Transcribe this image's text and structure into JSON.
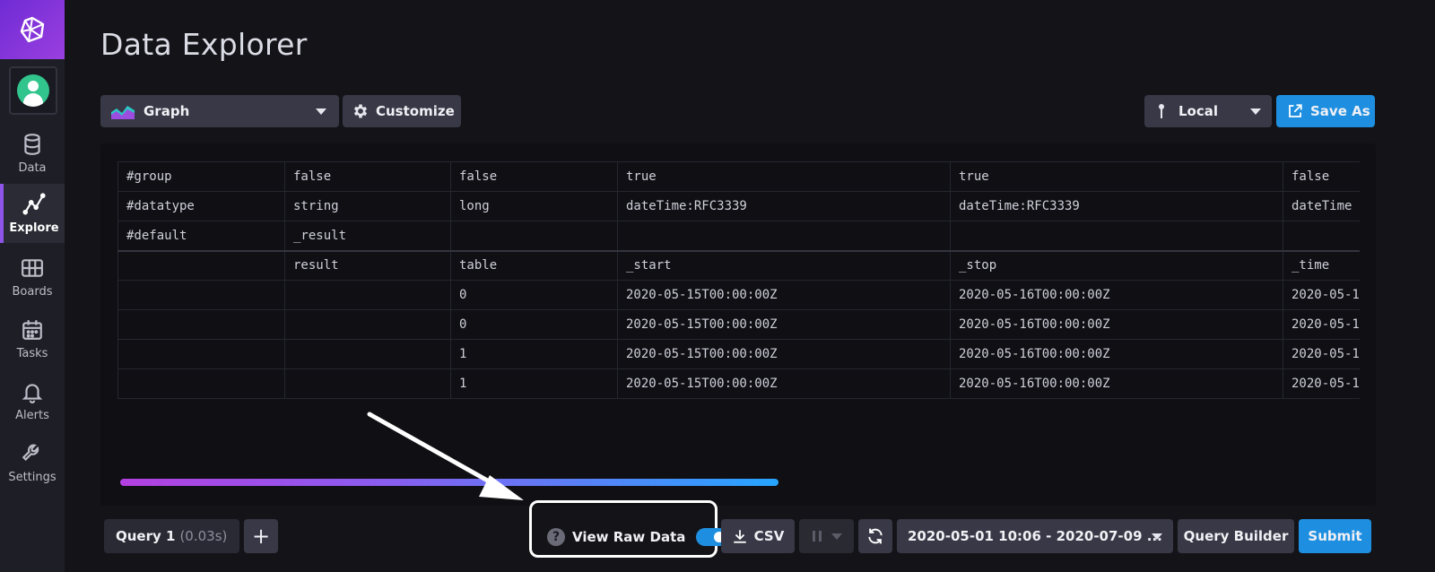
{
  "sidebar": {
    "logo_icon": "influx-cube-icon",
    "avatar_icon": "user-avatar-icon",
    "items": [
      {
        "label": "Data",
        "icon": "database-icon"
      },
      {
        "label": "Explore",
        "icon": "graph-line-icon",
        "active": true
      },
      {
        "label": "Boards",
        "icon": "grid-icon"
      },
      {
        "label": "Tasks",
        "icon": "calendar-icon"
      },
      {
        "label": "Alerts",
        "icon": "bell-icon"
      },
      {
        "label": "Settings",
        "icon": "wrench-icon"
      }
    ]
  },
  "header": {
    "title": "Data Explorer"
  },
  "toolbar": {
    "view_type": "Graph",
    "customize_label": "Customize",
    "timezone": "Local",
    "save_as_label": "Save As"
  },
  "table": {
    "rows": [
      [
        "#group",
        "false",
        "false",
        "true",
        "true",
        "false"
      ],
      [
        "#datatype",
        "string",
        "long",
        "dateTime:RFC3339",
        "dateTime:RFC3339",
        "dateTime"
      ],
      [
        "#default",
        "_result",
        "",
        "",
        "",
        ""
      ],
      [
        "",
        "result",
        "table",
        "_start",
        "_stop",
        "_time"
      ],
      [
        "",
        "",
        "0",
        "2020-05-15T00:00:00Z",
        "2020-05-16T00:00:00Z",
        "2020-05-1"
      ],
      [
        "",
        "",
        "0",
        "2020-05-15T00:00:00Z",
        "2020-05-16T00:00:00Z",
        "2020-05-1"
      ],
      [
        "",
        "",
        "1",
        "2020-05-15T00:00:00Z",
        "2020-05-16T00:00:00Z",
        "2020-05-1"
      ],
      [
        "",
        "",
        "1",
        "2020-05-15T00:00:00Z",
        "2020-05-16T00:00:00Z",
        "2020-05-1"
      ]
    ]
  },
  "bottom": {
    "query_tab_label": "Query 1",
    "query_tab_time": "(0.03s)",
    "add_query_label": "+",
    "view_raw_label": "View Raw Data",
    "view_raw_enabled": true,
    "csv_label": "CSV",
    "time_range": "2020-05-01 10:06 - 2020-07-09 ...",
    "query_builder_label": "Query Builder",
    "submit_label": "Submit"
  },
  "colors": {
    "accent_blue": "#1e8fe0",
    "logo_purple": "#7a31d8",
    "scroll_gradient_start": "#b340e0",
    "scroll_gradient_end": "#26a5ff"
  }
}
